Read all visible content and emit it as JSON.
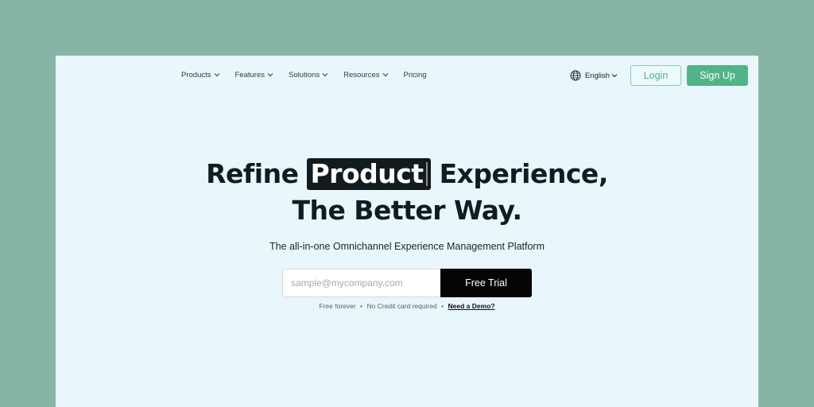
{
  "nav": {
    "items": [
      {
        "label": "Products",
        "has_dropdown": true
      },
      {
        "label": "Features",
        "has_dropdown": true
      },
      {
        "label": "Solutions",
        "has_dropdown": true
      },
      {
        "label": "Resources",
        "has_dropdown": true
      },
      {
        "label": "Pricing",
        "has_dropdown": false
      }
    ],
    "language": {
      "icon": "globe-icon",
      "label": "English"
    },
    "login_label": "Login",
    "signup_label": "Sign Up"
  },
  "hero": {
    "headline_before": "Refine",
    "headline_highlight": "Product",
    "headline_after": "Experience,",
    "headline_line2": "The Better Way.",
    "subtitle": "The all-in-one Omnichannel Experience Management Platform",
    "email_placeholder": "sample@mycompany.com",
    "email_value": "",
    "cta_label": "Free Trial",
    "fineprint_1": "Free forever",
    "fineprint_2": "No Credit card required",
    "separator": "•",
    "demo_link": "Need a Demo?"
  },
  "colors": {
    "outer_bg": "#86b5a5",
    "panel_bg": "#e9f6fc",
    "accent_green": "#52b388",
    "headline_dark": "#121c1e",
    "cta_black": "#050505"
  }
}
